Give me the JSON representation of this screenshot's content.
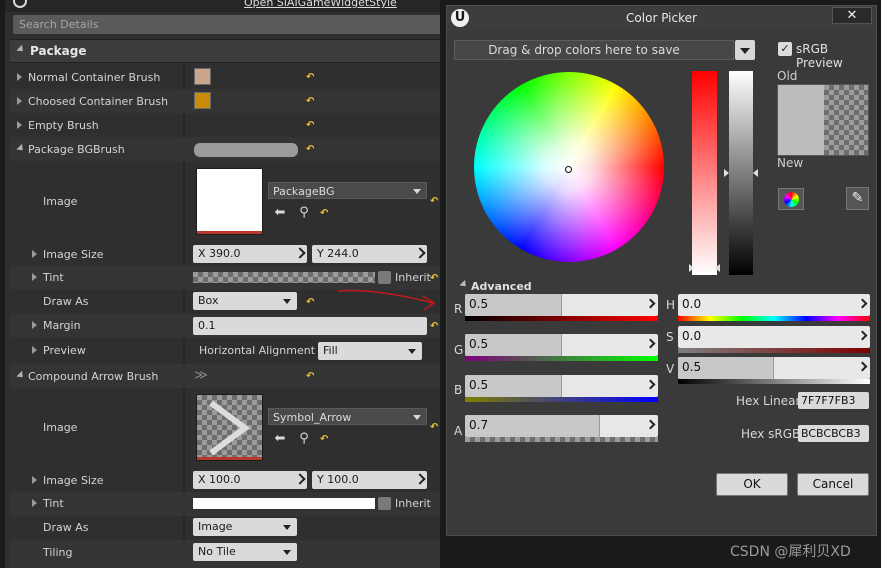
{
  "details": {
    "open_link": "Open SlAIGameWidgetStyle",
    "search_placeholder": "Search Details",
    "category": "Package",
    "rows": {
      "normal_container_brush": "Normal Container Brush",
      "choosed_container_brush": "Choosed Container Brush",
      "empty_brush": "Empty Brush",
      "package_bgbrush": "Package BGBrush",
      "image": "Image",
      "image_size": "Image Size",
      "tint": "Tint",
      "draw_as": "Draw As",
      "margin": "Margin",
      "preview": "Preview",
      "compound_arrow_brush": "Compound Arrow Brush",
      "image2": "Image",
      "image_size2": "Image Size",
      "tint2": "Tint",
      "draw_as2": "Draw As",
      "tiling": "Tiling"
    },
    "values": {
      "package_bg_asset": "PackageBG",
      "size_x": "X  390.0",
      "size_y": "Y  244.0",
      "inherit": "Inherit",
      "draw_as": "Box",
      "margin": "0.1",
      "horizontal_alignment_label": "Horizontal Alignment",
      "horizontal_alignment": "Fill",
      "arrow_asset": "Symbol_Arrow",
      "size_x2": "X  100.0",
      "size_y2": "Y  100.0",
      "inherit2": "Inherit",
      "draw_as2": "Image",
      "tiling": "No Tile"
    },
    "colors": {
      "normal_container": "#c9a58c",
      "choosed_container": "#c98c0a"
    }
  },
  "picker": {
    "title": "Color Picker",
    "close": "✕",
    "drop_text": "Drag & drop colors here to save",
    "srgb_preview": "sRGB Preview",
    "old": "Old",
    "new": "New",
    "advanced": "Advanced",
    "channels": {
      "r_label": "R",
      "r_value": "0.5",
      "r_fraction": 0.5,
      "g_label": "G",
      "g_value": "0.5",
      "g_fraction": 0.5,
      "b_label": "B",
      "b_value": "0.5",
      "b_fraction": 0.5,
      "a_label": "A",
      "a_value": "0.7",
      "a_fraction": 0.7,
      "h_label": "H",
      "h_value": "0.0",
      "s_label": "S",
      "s_value": "0.0",
      "v_label": "V",
      "v_value": "0.5",
      "v_fraction": 0.5
    },
    "hex_linear_label": "Hex Linear",
    "hex_linear": "7F7F7FB3",
    "hex_srgb_label": "Hex sRGB",
    "hex_srgb": "BCBCBCB3",
    "ok": "OK",
    "cancel": "Cancel",
    "current_color": "#bcbcbc"
  },
  "watermark": "CSDN @犀利贝XD"
}
